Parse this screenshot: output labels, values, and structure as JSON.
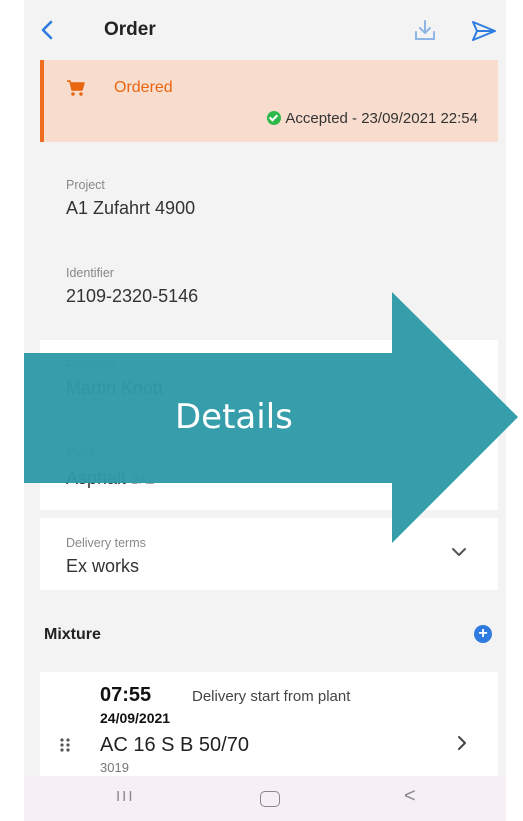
{
  "header": {
    "title": "Order"
  },
  "status": {
    "label": "Ordered",
    "accepted_text": "Accepted - 23/09/2021 22:54"
  },
  "fields": {
    "project_label": "Project",
    "project_value": "A1 Zufahrt 4900",
    "identifier_label": "Identifier",
    "identifier_value": "2109-2320-5146",
    "foreman_label": "Foreman",
    "foreman_value": "Martin Knott",
    "foreman_clear": "×",
    "plant_label": "Plant",
    "plant_value": "Asphalt",
    "plant_suffix": "BAZ",
    "delivery_label": "Delivery terms",
    "delivery_value": "Ex works"
  },
  "mixture": {
    "section_title": "Mixture",
    "add_symbol": "+",
    "items": [
      {
        "time": "07:55",
        "description": "Delivery start from plant",
        "date": "24/09/2021",
        "name": "AC 16 S B 50/70",
        "code": "3019"
      }
    ]
  },
  "navbar": {
    "recent": "III",
    "back": "<"
  },
  "overlay": {
    "label": "Details"
  },
  "icons": {
    "back": "chevron-left-icon",
    "download": "download-icon",
    "send": "send-icon",
    "status": "cart-icon",
    "accepted": "check-circle-icon",
    "clear": "close-icon",
    "dropdown": "chevron-down-icon",
    "add": "plus-circle-icon",
    "drag": "drag-handle-icon",
    "open": "chevron-right-icon"
  },
  "colors": {
    "accent": "#2e7ce0",
    "status_bg": "#f8ddcf",
    "status_accent": "#ee6c1e",
    "accepted": "#2fb84a",
    "overlay_arrow": "#2e9aa8"
  }
}
